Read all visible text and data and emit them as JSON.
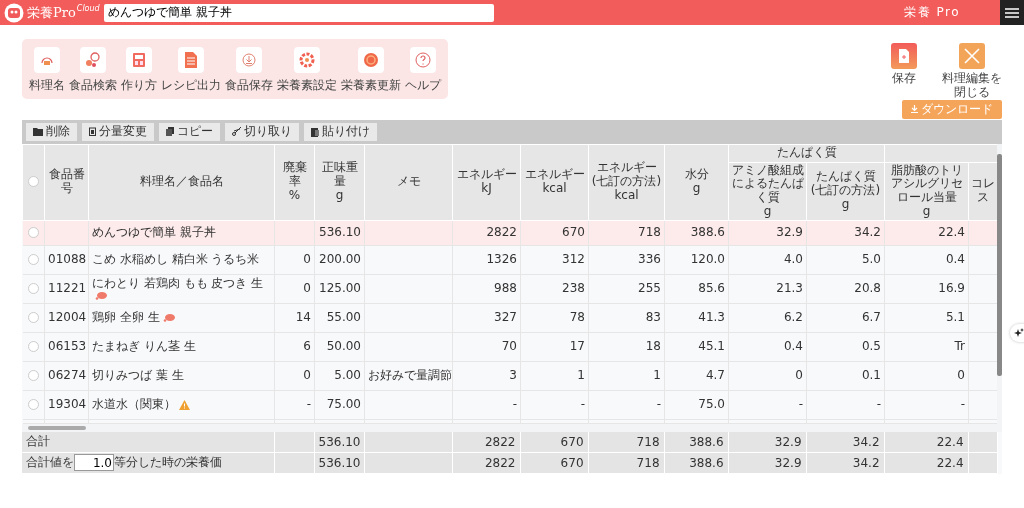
{
  "app": {
    "logo": "栄養Pro",
    "logo_sup": "Cloud",
    "search_value": "めんつゆで簡単 親子丼",
    "user": "栄養 Pro"
  },
  "tools": [
    {
      "label": "料理名",
      "kind": "dish"
    },
    {
      "label": "食品検索",
      "kind": "search"
    },
    {
      "label": "作り方",
      "kind": "recipe"
    },
    {
      "label": "レシピ出力",
      "kind": "doc"
    },
    {
      "label": "食品保存",
      "kind": "save"
    },
    {
      "label": "栄養素設定",
      "kind": "gear"
    },
    {
      "label": "栄養素更新",
      "kind": "refresh"
    },
    {
      "label": "ヘルプ",
      "kind": "help"
    }
  ],
  "actions": [
    {
      "label": "保存",
      "kind": "save"
    },
    {
      "label": "料理編集を閉じる",
      "kind": "close"
    }
  ],
  "download": "ダウンロード",
  "table_buttons": [
    {
      "label": "削除",
      "kind": "delete"
    },
    {
      "label": "分量変更",
      "kind": "amount"
    },
    {
      "label": "コピー",
      "kind": "copy"
    },
    {
      "label": "切り取り",
      "kind": "cut"
    },
    {
      "label": "貼り付け",
      "kind": "paste"
    }
  ],
  "columns": [
    {
      "kind": "single",
      "label": "食品番号"
    },
    {
      "kind": "single",
      "label": "料理名／食品名"
    },
    {
      "kind": "single",
      "label": "廃棄率",
      "unit": "%"
    },
    {
      "kind": "single",
      "label": "正味重量",
      "unit": "g"
    },
    {
      "kind": "single",
      "label": "メモ"
    },
    {
      "kind": "single",
      "label": "エネルギー",
      "unit": "kJ"
    },
    {
      "kind": "single",
      "label": "エネルギー",
      "unit": "kcal"
    },
    {
      "kind": "single",
      "label": "エネルギー(七訂の方法)",
      "unit": "kcal"
    },
    {
      "kind": "single",
      "label": "水分",
      "unit": "g"
    },
    {
      "kind": "group",
      "label": "たんぱく質",
      "children": [
        {
          "label": "アミノ酸組成によるたんぱく質",
          "unit": "g"
        },
        {
          "label": "たんぱく質(七訂の方法)",
          "unit": "g"
        }
      ]
    },
    {
      "kind": "group",
      "children": [
        {
          "label": "脂肪酸のトリアシルグリセロール当量",
          "unit": "g"
        },
        {
          "label": "コレス"
        }
      ]
    }
  ],
  "all_selected": false,
  "rows": [
    {
      "kind": "dish",
      "selected": false,
      "cells": [
        null,
        "めんつゆで簡単 親子丼",
        null,
        "536.10",
        null,
        "2822",
        "670",
        "718",
        "388.6",
        "32.9",
        "34.2",
        "22.4",
        null
      ]
    },
    {
      "kind": "food",
      "selected": false,
      "cells": [
        "01088",
        "こめ 水稲めし 精白米 うるち米",
        "0",
        "200.00",
        null,
        "1326",
        "312",
        "336",
        "120.0",
        "4.0",
        "5.0",
        "0.4",
        null
      ]
    },
    {
      "kind": "allergen",
      "selected": false,
      "cells": [
        "11221",
        "にわとり 若鶏肉 もも 皮つき 生",
        "0",
        "125.00",
        null,
        "988",
        "238",
        "255",
        "85.6",
        "21.3",
        "20.8",
        "16.9",
        null
      ]
    },
    {
      "kind": "allergen",
      "selected": false,
      "cells": [
        "12004",
        "鶏卵 全卵 生",
        "14",
        "55.00",
        null,
        "327",
        "78",
        "83",
        "41.3",
        "6.2",
        "6.7",
        "5.1",
        null
      ]
    },
    {
      "kind": "food",
      "selected": false,
      "cells": [
        "06153",
        "たまねぎ りん茎 生",
        "6",
        "50.00",
        null,
        "70",
        "17",
        "18",
        "45.1",
        "0.4",
        "0.5",
        "Tr",
        null
      ]
    },
    {
      "kind": "food",
      "selected": false,
      "cells": [
        "06274",
        "切りみつば 葉 生",
        "0",
        "5.00",
        "お好みで量調節",
        "3",
        "1",
        "1",
        "4.7",
        "0",
        "0.1",
        "0",
        null
      ]
    },
    {
      "kind": "warning",
      "selected": false,
      "cells": [
        "19304",
        "水道水（関東）",
        "-",
        "75.00",
        null,
        "-",
        "-",
        "-",
        "75.0",
        "-",
        "-",
        "-",
        null
      ]
    }
  ],
  "totals": [
    {
      "kind": "sum",
      "label": "合計",
      "cells": [
        null,
        "536.10",
        null,
        "2822",
        "670",
        "718",
        "388.6",
        "32.9",
        "34.2",
        "22.4",
        null
      ]
    },
    {
      "kind": "divide",
      "label": "合計値を",
      "value": "1.0",
      "suffix": "等分した時の栄養価",
      "cells": [
        null,
        "536.10",
        null,
        "2822",
        "670",
        "718",
        "388.6",
        "32.9",
        "34.2",
        "22.4",
        null
      ]
    }
  ]
}
